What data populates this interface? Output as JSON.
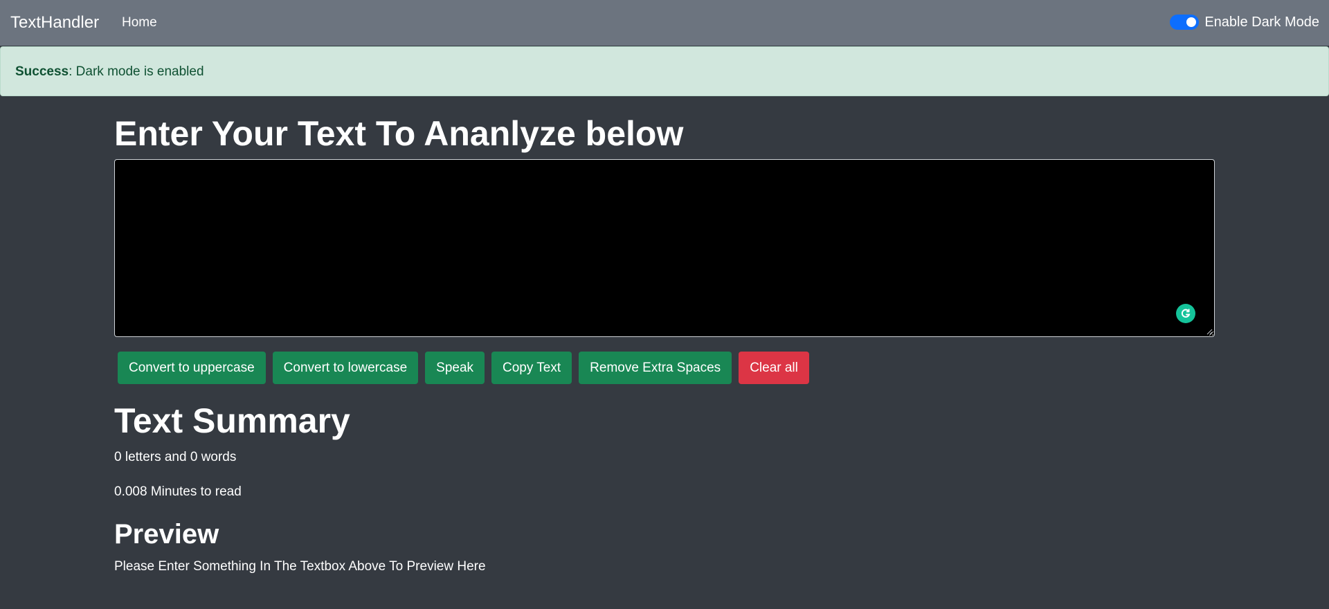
{
  "navbar": {
    "brand": "TextHandler",
    "home_link": "Home",
    "dark_mode_label": "Enable Dark Mode",
    "dark_mode_enabled": true
  },
  "alert": {
    "type_label": "Success",
    "message": ": Dark mode is enabled",
    "background": "#d1e7dd",
    "text_color": "#0f5132"
  },
  "main": {
    "heading": "Enter Your Text To Ananlyze below",
    "textarea_value": "",
    "icons": {
      "grammar": "grammarly-icon"
    },
    "buttons": [
      {
        "label": "Convert to uppercase",
        "color": "#198754"
      },
      {
        "label": "Convert to lowercase",
        "color": "#198754"
      },
      {
        "label": "Speak",
        "color": "#198754"
      },
      {
        "label": "Copy Text",
        "color": "#198754"
      },
      {
        "label": "Remove Extra Spaces",
        "color": "#198754"
      },
      {
        "label": "Clear all",
        "color": "#dc3545"
      }
    ]
  },
  "summary": {
    "heading": "Text Summary",
    "counts": "0 letters and 0 words",
    "read_time": "0.008 Minutes to read"
  },
  "preview": {
    "heading": "Preview",
    "text": "Please Enter Something In The Textbox Above To Preview Here"
  },
  "colors": {
    "page_background": "#353a41",
    "navbar_background": "#6c747f",
    "toggle_on": "#0d6efd"
  }
}
